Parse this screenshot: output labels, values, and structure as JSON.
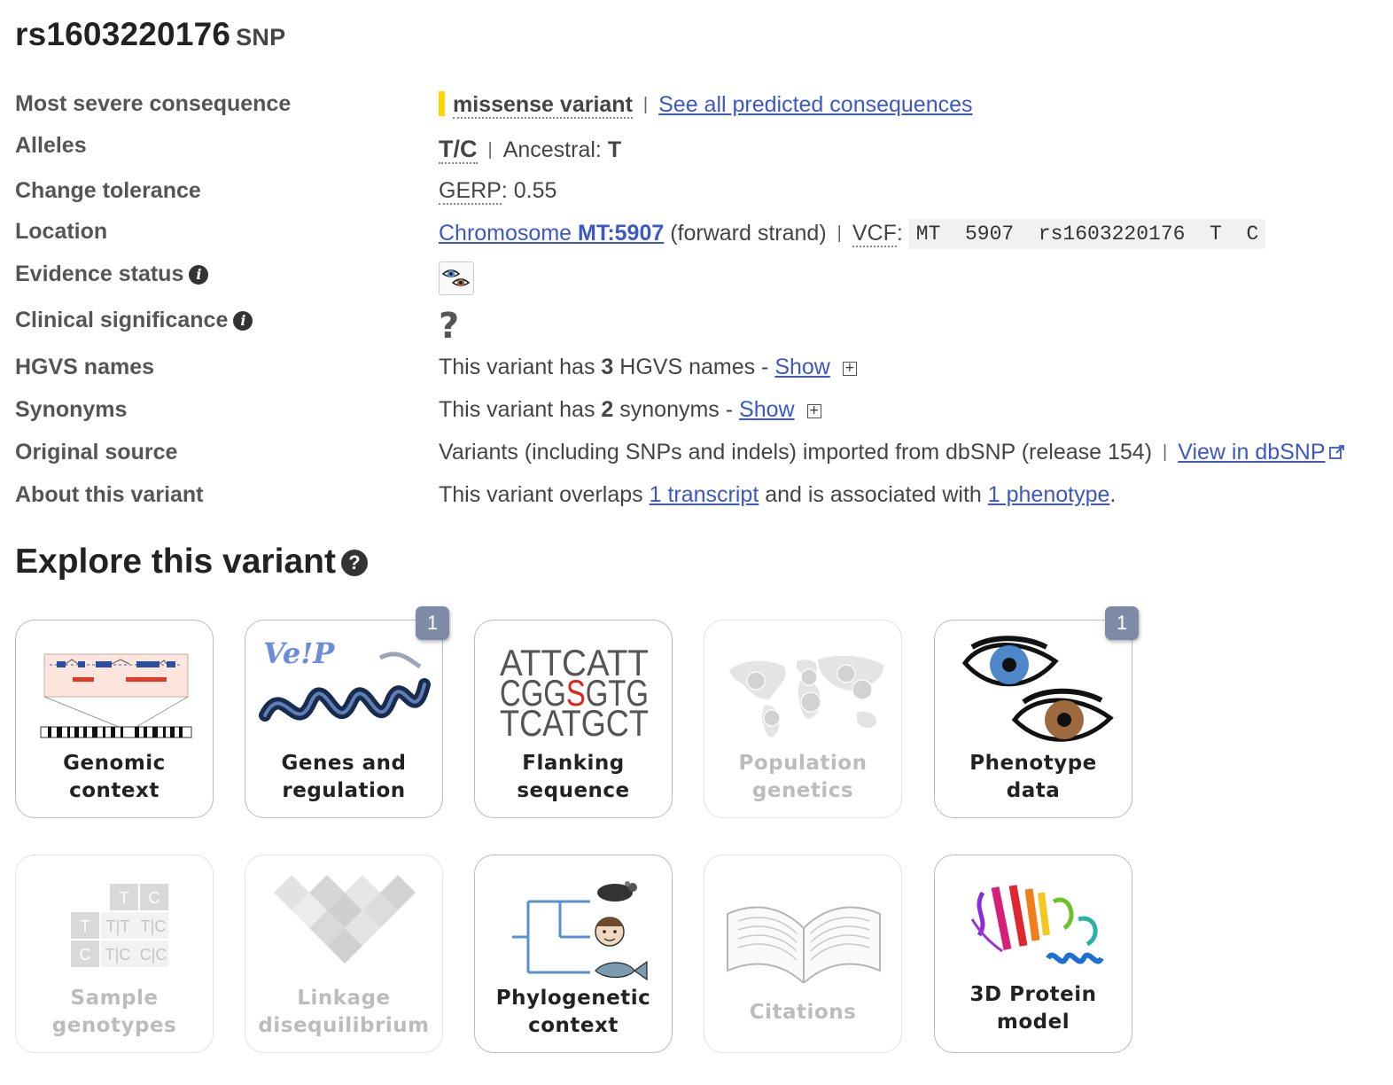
{
  "header": {
    "id": "rs1603220176",
    "type": "SNP"
  },
  "rows": {
    "consequence": {
      "label": "Most severe consequence",
      "value": "missense variant",
      "link": "See all predicted consequences"
    },
    "alleles": {
      "label": "Alleles",
      "value": "T/C",
      "ancestral_label": "Ancestral:",
      "ancestral": "T"
    },
    "tolerance": {
      "label": "Change tolerance",
      "abbr": "GERP",
      "value": ": 0.55"
    },
    "location": {
      "label": "Location",
      "link_prefix": "Chromosome ",
      "link_bold": "MT:5907",
      "strand": "(forward strand)",
      "vcf_label": "VCF",
      "vcf_colon": ":",
      "vcf": "MT  5907  rs1603220176  T  C"
    },
    "evidence": {
      "label": "Evidence status"
    },
    "clinical": {
      "label": "Clinical significance",
      "value": "?"
    },
    "hgvs": {
      "label": "HGVS names",
      "prefix": "This variant has ",
      "count": "3",
      "suffix": " HGVS names - ",
      "link": "Show"
    },
    "synonyms": {
      "label": "Synonyms",
      "prefix": "This variant has ",
      "count": "2",
      "suffix": " synonyms - ",
      "link": "Show"
    },
    "source": {
      "label": "Original source",
      "value": "Variants (including SNPs and indels) imported from dbSNP (release 154)",
      "link": "View in dbSNP"
    },
    "about": {
      "label": "About this variant",
      "p1": "This variant overlaps ",
      "link1": "1 transcript",
      "p2": " and is associated with ",
      "link2": "1 phenotype",
      "p3": "."
    }
  },
  "explore": {
    "title": "Explore this variant",
    "tiles": [
      {
        "line1": "Genomic",
        "line2": "context",
        "enabled": true
      },
      {
        "line1": "Genes and",
        "line2": "regulation",
        "enabled": true,
        "badge": "1",
        "vep_text": "Ve!P"
      },
      {
        "line1": "Flanking",
        "line2": "sequence",
        "enabled": true,
        "seq1": "ATTCATT",
        "seq2a": "CGG",
        "seq2b": "S",
        "seq2c": "GTG",
        "seq3": "TCATGCT"
      },
      {
        "line1": "Population",
        "line2": "genetics",
        "enabled": false
      },
      {
        "line1": "Phenotype",
        "line2": "data",
        "enabled": true,
        "badge": "1"
      },
      {
        "line1": "Sample",
        "line2": "genotypes",
        "enabled": false,
        "g": [
          "T",
          "C",
          "T",
          "T|T",
          "T|C",
          "C",
          "T|C",
          "C|C"
        ]
      },
      {
        "line1": "Linkage",
        "line2": "disequilibrium",
        "enabled": false
      },
      {
        "line1": "Phylogenetic",
        "line2": "context",
        "enabled": true
      },
      {
        "line1": "Citations",
        "enabled": false
      },
      {
        "line1": "3D Protein",
        "line2": "model",
        "enabled": true
      }
    ]
  },
  "colors": {
    "link": "#3c58c7",
    "severity": "#ffd700",
    "badge": "#7e8ba6"
  }
}
